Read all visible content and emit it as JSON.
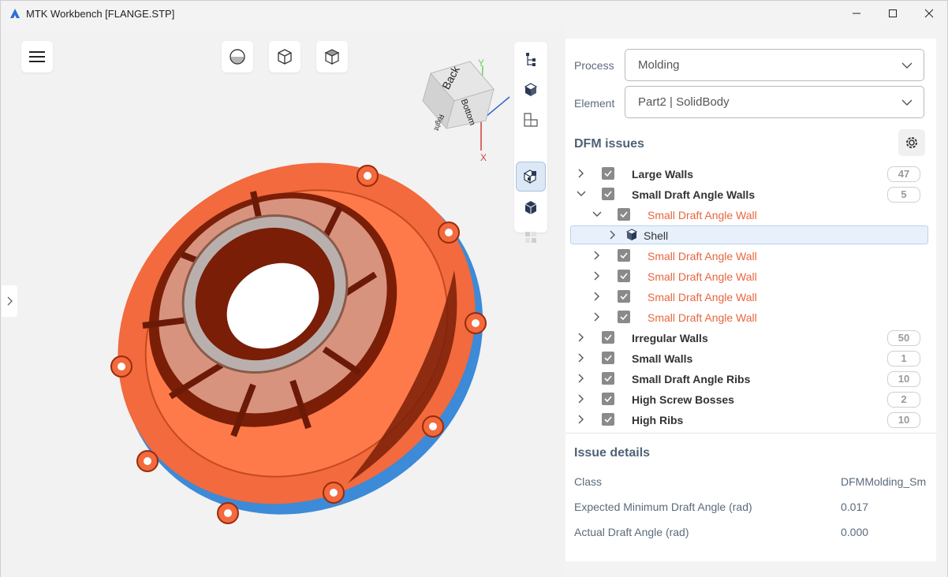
{
  "window": {
    "title": "MTK Workbench [FLANGE.STP]",
    "minimize": "—",
    "maximize": "☐",
    "close": "✕"
  },
  "viewcube": {
    "face_back": "Back",
    "face_bottom": "Bottom",
    "face_right": "Right",
    "axis_y": "Y",
    "axis_x": "X"
  },
  "panel": {
    "process_label": "Process",
    "process_value": "Molding",
    "element_label": "Element",
    "element_value": "Part2 | SolidBody",
    "dfm_title": "DFM issues",
    "issues": [
      {
        "label": "Large Walls",
        "count": "47",
        "expanded": false
      },
      {
        "label": "Small Draft Angle Walls",
        "count": "5",
        "expanded": true
      },
      {
        "label": "Small Draft Angle Wall"
      },
      {
        "label": "Shell"
      },
      {
        "label": "Small Draft Angle Wall"
      },
      {
        "label": "Small Draft Angle Wall"
      },
      {
        "label": "Small Draft Angle Wall"
      },
      {
        "label": "Small Draft Angle Wall"
      },
      {
        "label": "Irregular Walls",
        "count": "50"
      },
      {
        "label": "Small Walls",
        "count": "1"
      },
      {
        "label": "Small Draft Angle Ribs",
        "count": "10"
      },
      {
        "label": "High Screw Bosses",
        "count": "2"
      },
      {
        "label": "High Ribs",
        "count": "10"
      }
    ]
  },
  "details": {
    "title": "Issue details",
    "rows": [
      {
        "key": "Class",
        "value": "DFMMolding_Sm"
      },
      {
        "key": "Expected Minimum Draft Angle (rad)",
        "value": "0.017"
      },
      {
        "key": "Actual Draft Angle (rad)",
        "value": "0.000"
      }
    ]
  },
  "colors": {
    "accent": "#e8663f",
    "part_orange": "#f26a3d",
    "part_dark": "#7a1e08",
    "selected_row": "#e8f1fb"
  }
}
